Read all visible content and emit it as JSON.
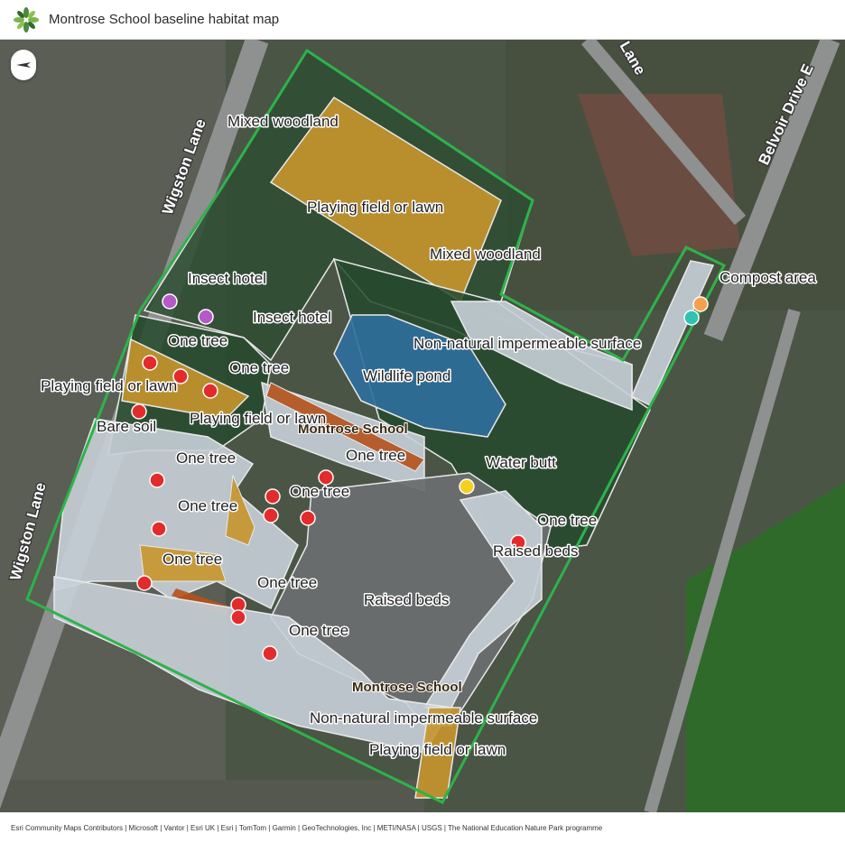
{
  "header": {
    "title": "Montrose School baseline habitat map"
  },
  "roads": {
    "wigston_1": "Wigston Lane",
    "wigston_2": "Wigston Lane",
    "belvoir": "Belvoir Drive E",
    "lane_top": "Lane"
  },
  "schools": {
    "school_1": "Montrose School",
    "school_2": "Montrose School"
  },
  "habitat_labels": {
    "mixed_woodland_1": "Mixed woodland",
    "playing_field_1": "Playing field or lawn",
    "mixed_woodland_2": "Mixed woodland",
    "compost_area": "Compost area",
    "insect_hotel_1": "Insect hotel",
    "insect_hotel_2": "Insect hotel",
    "one_tree_1": "One tree",
    "non_natural_1": "Non-natural impermeable surface",
    "one_tree_2": "One tree",
    "wildlife_pond": "Wildlife pond",
    "playing_field_2": "Playing field or lawn",
    "playing_field_3": "Playing field or lawn",
    "bare_soil": "Bare soil",
    "one_tree_3": "One tree",
    "one_tree_4": "One tree",
    "water_butt": "Water butt",
    "one_tree_5": "One tree",
    "one_tree_6": "One tree",
    "one_tree_7": "One tree",
    "raised_beds_1": "Raised beds",
    "one_tree_8": "One tree",
    "one_tree_9": "One tree",
    "raised_beds_2": "Raised beds",
    "one_tree_10": "One tree",
    "non_natural_2": "Non-natural impermeable surface",
    "playing_field_4": "Playing field or lawn"
  },
  "colors": {
    "boundary": "#2db34a",
    "woodland": "#2e4d32",
    "lawn": "#c8962c",
    "impermeable": "#c8d0d8",
    "pond": "#2f6f9e",
    "bare_soil": "#b5521c",
    "tree_marker": "#e32b2b",
    "insect_marker": "#b45ac8",
    "compost_marker_1": "#f5a050",
    "compost_marker_2": "#2ec4b0",
    "water_butt_marker": "#f5d020"
  },
  "attribution": "Esri Community Maps Contributors | Microsoft | Vantor | Esri UK | Esri | TomTom | Garmin | GeoTechnologies, Inc | METI/NASA | USGS | The National Education Nature Park programme"
}
